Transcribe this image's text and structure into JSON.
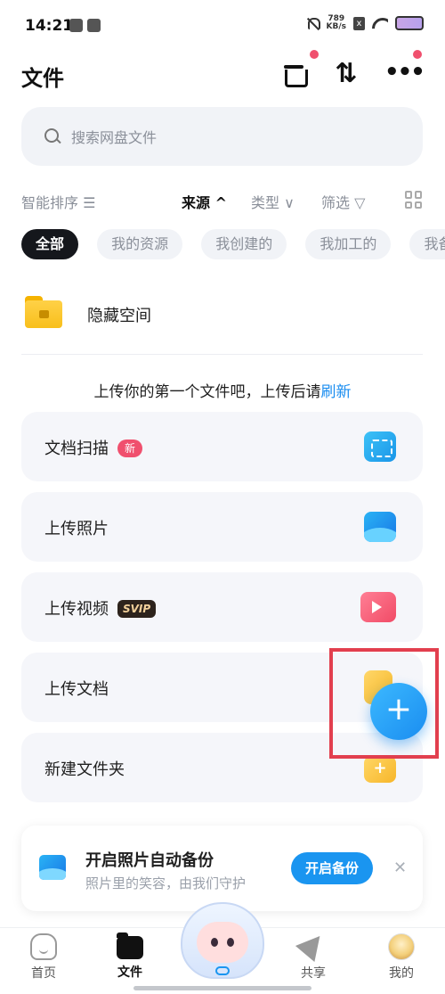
{
  "status_bar": {
    "time": "14:21",
    "net_speed_top": "789",
    "net_speed_bottom": "KB/s",
    "sim_label": "x"
  },
  "header": {
    "title": "文件",
    "sort_glyph": "⇅",
    "more_glyph": "•••"
  },
  "search": {
    "placeholder": "搜索网盘文件"
  },
  "filter_row": {
    "smart_sort": "智能排序 ☰",
    "source": "来源 ^",
    "type": "类型 ∨",
    "filter": "筛选 ▽"
  },
  "chips": [
    "全部",
    "我的资源",
    "我创建的",
    "我加工的",
    "我备份"
  ],
  "hidden_space": {
    "label": "隐藏空间"
  },
  "upload_hint": {
    "text": "上传你的第一个文件吧，上传后请",
    "link": "刷新"
  },
  "actions": [
    {
      "label": "文档扫描",
      "badge": "新"
    },
    {
      "label": "上传照片"
    },
    {
      "label": "上传视频",
      "badge": "SVIP"
    },
    {
      "label": "上传文档"
    },
    {
      "label": "新建文件夹"
    }
  ],
  "fab": {
    "glyph": "+"
  },
  "backup_banner": {
    "title": "开启照片自动备份",
    "subtitle": "照片里的笑容，由我们守护",
    "button": "开启备份",
    "close_glyph": "✕"
  },
  "bottom_nav": {
    "items": [
      {
        "label": "首页"
      },
      {
        "label": "文件"
      },
      {
        "label": "共享"
      },
      {
        "label": "我的"
      }
    ]
  },
  "colors": {
    "accent": "#1a8df0",
    "badge_red": "#f0506e",
    "highlight": "#e23f4e"
  }
}
